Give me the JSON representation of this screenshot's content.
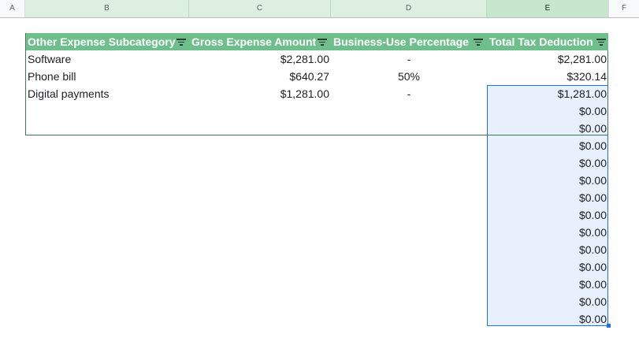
{
  "column_headers": [
    "A",
    "B",
    "C",
    "D",
    "E",
    "F"
  ],
  "table": {
    "headers": [
      "Other Expense Subcategory",
      "Gross Expense Amount",
      "Business-Use Percentage",
      "Total Tax Deduction"
    ],
    "rows": [
      [
        "Software",
        "$2,281.00",
        "-",
        "$2,281.00"
      ],
      [
        "Phone bill",
        "$640.27",
        "50%",
        "$320.14"
      ],
      [
        "Digital payments",
        "$1,281.00",
        "-",
        "$1,281.00"
      ],
      [
        "",
        "",
        "",
        "$0.00"
      ],
      [
        "",
        "",
        "",
        "$0.00"
      ]
    ]
  },
  "column_e_extra": [
    "$0.00",
    "$0.00",
    "$0.00",
    "$0.00",
    "$0.00",
    "$0.00",
    "$0.00",
    "$0.00",
    "$0.00",
    "$0.00",
    "$0.00"
  ],
  "colors": {
    "table_header_bg": "#6fbf8d",
    "table_border": "#3e7a52",
    "selection_border": "#1a73e8",
    "selection_fill": "#e8f0fe"
  },
  "icons": {
    "filter": "filter-icon"
  }
}
